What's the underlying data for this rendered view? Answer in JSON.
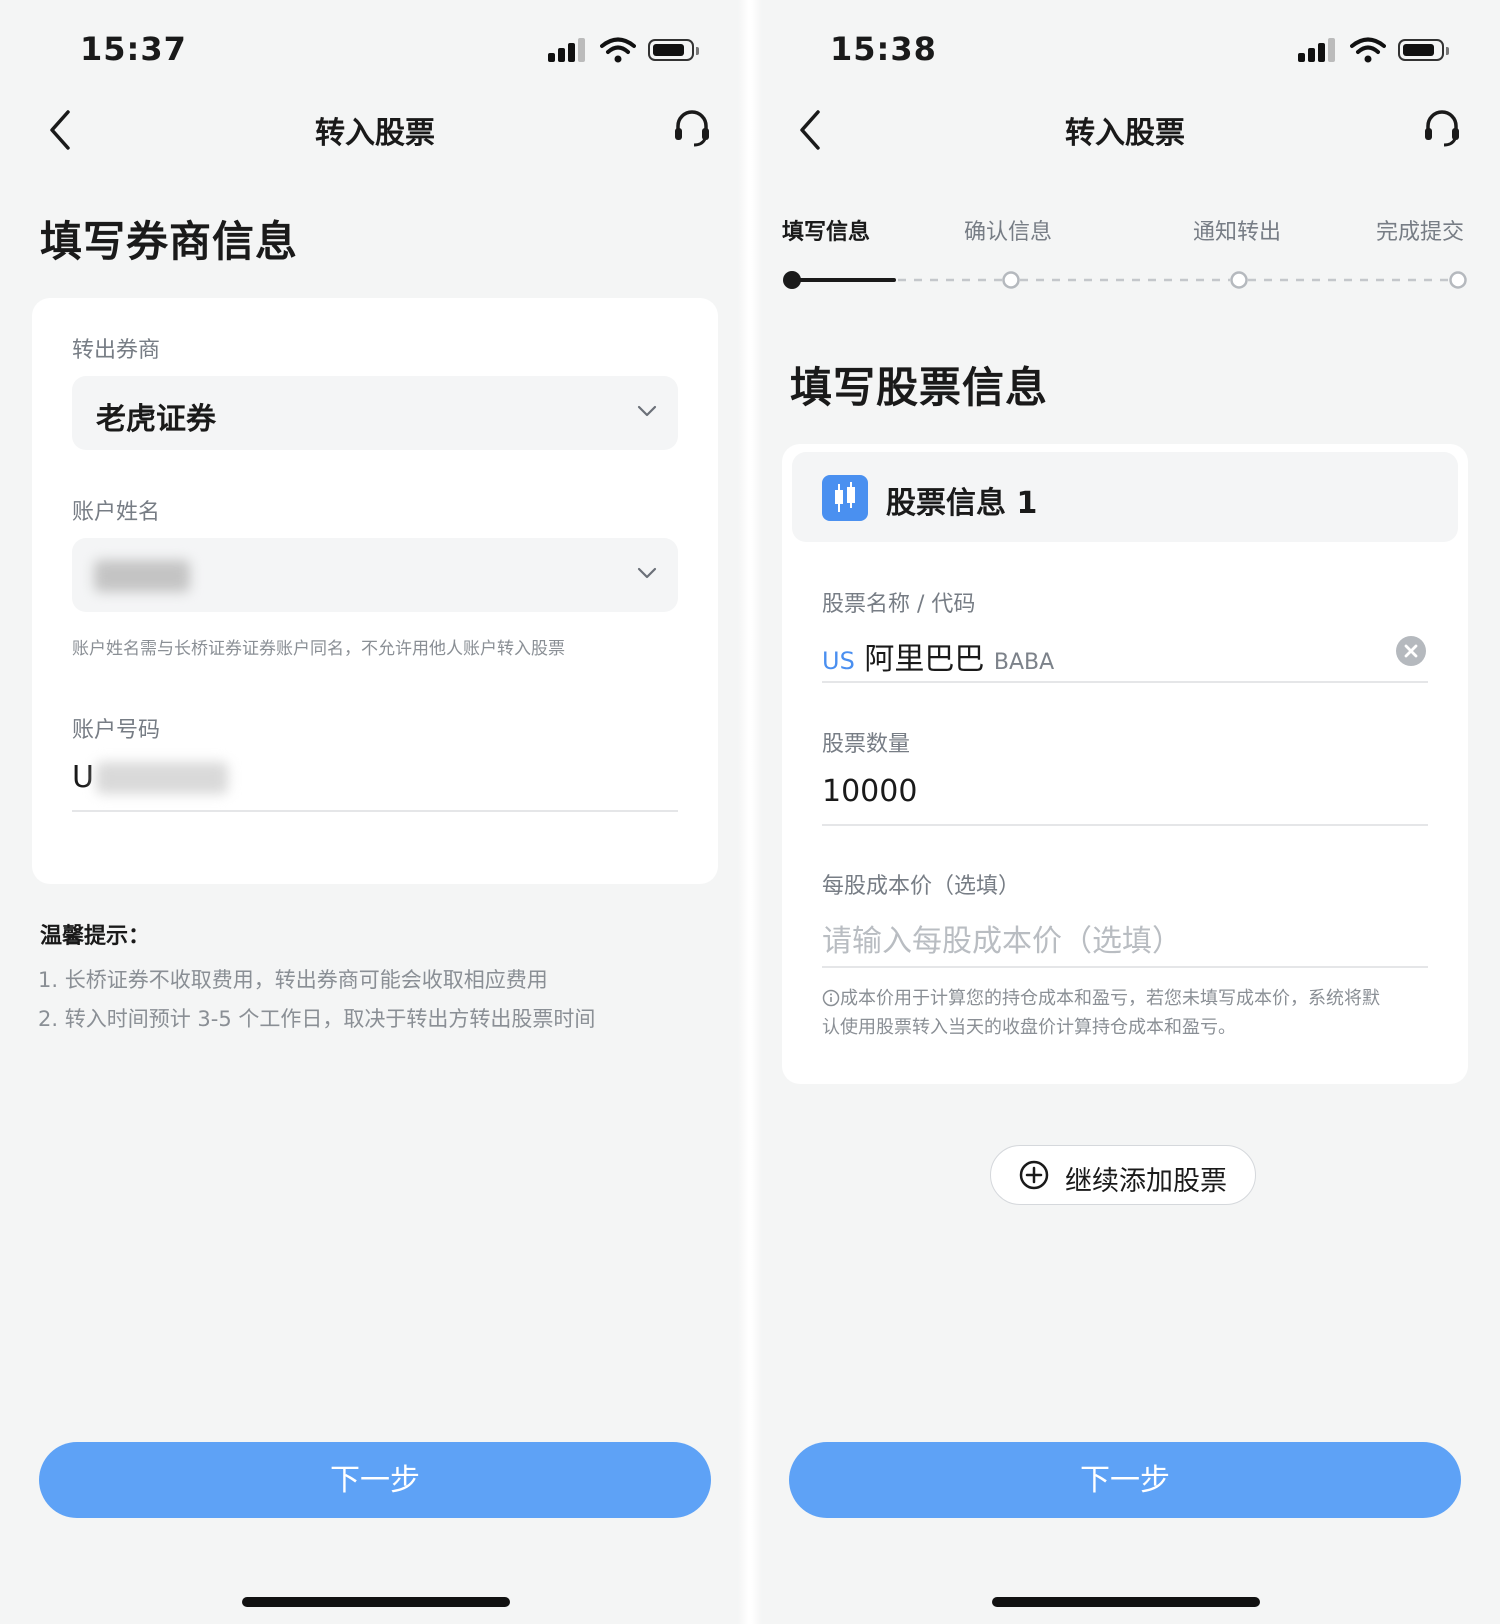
{
  "left_screen": {
    "status": {
      "time": "15:37"
    },
    "nav": {
      "title": "转入股票"
    },
    "heading": "填写券商信息",
    "broker_field": {
      "label": "转出券商",
      "value": "老虎证券"
    },
    "name_field": {
      "label": "账户姓名",
      "hint": "账户姓名需与长桥证券证券账户同名，不允许用他人账户转入股票"
    },
    "account_field": {
      "label": "账户号码",
      "value_prefix": "U"
    },
    "tips": {
      "title": "温馨提示：",
      "items": [
        "1.  长桥证券不收取费用，转出券商可能会收取相应费用",
        "2.  转入时间预计 3-5 个工作日，取决于转出方转出股票时间"
      ]
    },
    "next_button": "下一步"
  },
  "right_screen": {
    "status": {
      "time": "15:38"
    },
    "nav": {
      "title": "转入股票"
    },
    "steps": [
      "填写信息",
      "确认信息",
      "通知转出",
      "完成提交"
    ],
    "current_step": 1,
    "heading": "填写股票信息",
    "stock_card": {
      "title": "股票信息 1",
      "name_label": "股票名称 / 代码",
      "market": "US",
      "stock_name": "阿里巴巴",
      "stock_code": "BABA",
      "quantity_label": "股票数量",
      "quantity_value": "10000",
      "cost_label": "每股成本价（选填）",
      "cost_placeholder": "请输入每股成本价（选填）",
      "note_line1": "成本价用于计算您的持仓成本和盈亏，若您未填写成本价，系统将默",
      "note_line2": "认使用股票转入当天的收盘价计算持仓成本和盈亏。"
    },
    "add_button": "继续添加股票",
    "next_button": "下一步"
  },
  "colors": {
    "accent": "#5ea2f6",
    "link": "#4a8ff0",
    "background": "#f4f5f5"
  }
}
